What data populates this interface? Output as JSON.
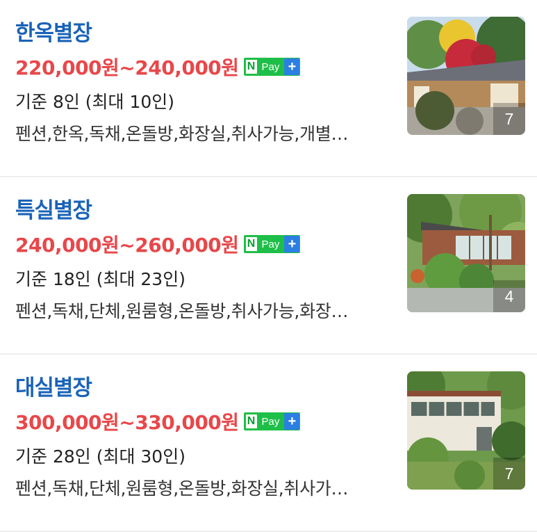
{
  "listings": [
    {
      "title": "한옥별장",
      "price": "220,000원~240,000원",
      "npay": {
        "n": "N",
        "pay": "Pay",
        "plus": "+"
      },
      "capacity": "기준 8인 (최대 10인)",
      "tags": "펜션,한옥,독채,온돌방,화장실,취사가능,개별…",
      "photo_count": "7"
    },
    {
      "title": "특실별장",
      "price": "240,000원~260,000원",
      "npay": {
        "n": "N",
        "pay": "Pay",
        "plus": "+"
      },
      "capacity": "기준 18인 (최대 23인)",
      "tags": "펜션,독채,단체,원룸형,온돌방,취사가능,화장…",
      "photo_count": "4"
    },
    {
      "title": "대실별장",
      "price": "300,000원~330,000원",
      "npay": {
        "n": "N",
        "pay": "Pay",
        "plus": "+"
      },
      "capacity": "기준 28인 (최대 30인)",
      "tags": "펜션,독채,단체,원룸형,온돌방,화장실,취사가…",
      "photo_count": "7"
    }
  ],
  "colors": {
    "title": "#1a63b8",
    "price": "#e8474a",
    "npay_green": "#1ebf48",
    "npay_blue": "#2b7fe3"
  }
}
